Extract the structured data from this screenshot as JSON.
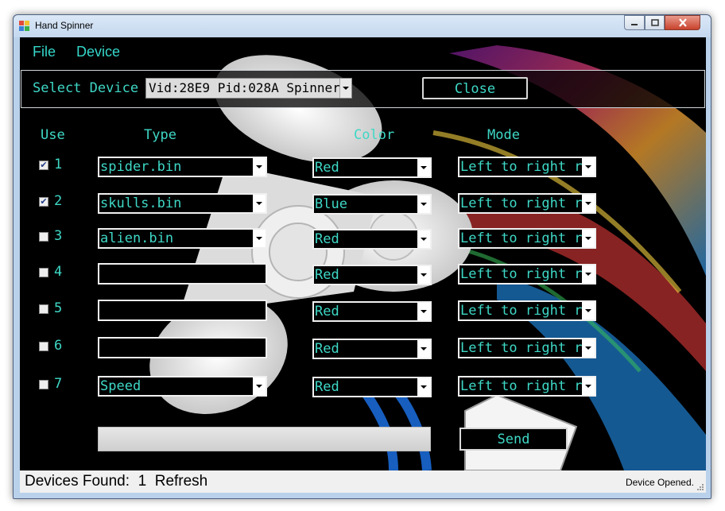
{
  "window": {
    "title": "Hand Spinner",
    "controls": {
      "minimize": "minimize",
      "maximize": "maximize",
      "close": "close"
    }
  },
  "menu": {
    "file": "File",
    "device": "Device"
  },
  "device_panel": {
    "select_label": "Select Device",
    "device_value": "Vid:28E9 Pid:028A Spinner",
    "close_label": "Close"
  },
  "headers": {
    "use": "Use",
    "type": "Type",
    "color": "Color",
    "mode": "Mode"
  },
  "rows": [
    {
      "num": "1",
      "checked": true,
      "type": "spider.bin",
      "type_is_combo": true,
      "color": "Red",
      "mode": "Left to right r"
    },
    {
      "num": "2",
      "checked": true,
      "type": "skulls.bin",
      "type_is_combo": true,
      "color": "Blue",
      "mode": "Left to right r"
    },
    {
      "num": "3",
      "checked": false,
      "type": "alien.bin",
      "type_is_combo": true,
      "color": "Red",
      "mode": "Left to right r"
    },
    {
      "num": "4",
      "checked": false,
      "type": "",
      "type_is_combo": false,
      "color": "Red",
      "mode": "Left to right r"
    },
    {
      "num": "5",
      "checked": false,
      "type": "",
      "type_is_combo": false,
      "color": "Red",
      "mode": "Left to right r"
    },
    {
      "num": "6",
      "checked": false,
      "type": "",
      "type_is_combo": false,
      "color": "Red",
      "mode": "Left to right r"
    },
    {
      "num": "7",
      "checked": false,
      "type": "Speed",
      "type_is_combo": true,
      "color": "Red",
      "mode": "Left to right r"
    }
  ],
  "progress": {
    "value": 0
  },
  "send_label": "Send",
  "status": {
    "devices_found_label": "Devices Found:",
    "devices_found_count": "1",
    "refresh_label": "Refresh",
    "device_state": "Device Opened."
  },
  "colors": {
    "accent": "#3ed8c6",
    "background": "#000000",
    "status_bar": "#f0f0f0"
  }
}
